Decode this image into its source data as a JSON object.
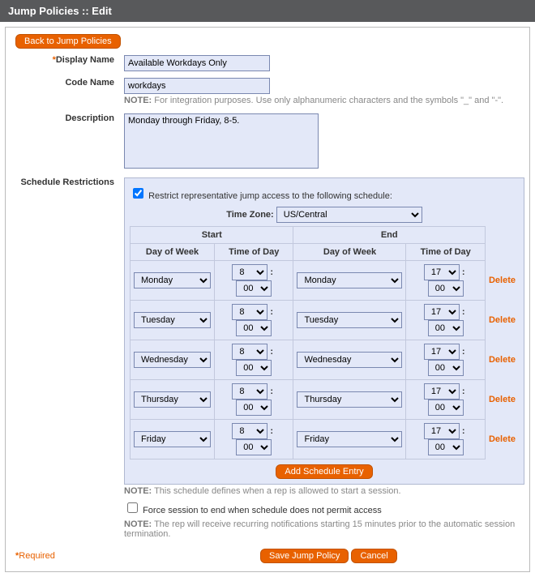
{
  "header_title": "Jump Policies :: Edit",
  "back_button": "Back to Jump Policies",
  "labels": {
    "display_name": "Display Name",
    "code_name": "Code Name",
    "description": "Description",
    "schedule_restrictions": "Schedule Restrictions"
  },
  "fields": {
    "display_name": "Available Workdays Only",
    "code_name": "workdays",
    "description": "Monday through Friday, 8-5."
  },
  "code_name_note_strong": "NOTE:",
  "code_name_note": " For integration purposes. Use only alphanumeric characters and the symbols \"_\" and \"-\".",
  "restrict_checked": true,
  "restrict_label": " Restrict representative jump access to the following schedule:",
  "timezone_label": "Time Zone: ",
  "timezone_value": "US/Central",
  "sched_headers": {
    "start": "Start",
    "end": "End",
    "day_of_week": "Day of Week",
    "time_of_day": "Time of Day"
  },
  "rows": [
    {
      "start_day": "Monday",
      "start_hr": "8",
      "start_min": "00",
      "end_day": "Monday",
      "end_hr": "17",
      "end_min": "00"
    },
    {
      "start_day": "Tuesday",
      "start_hr": "8",
      "start_min": "00",
      "end_day": "Tuesday",
      "end_hr": "17",
      "end_min": "00"
    },
    {
      "start_day": "Wednesday",
      "start_hr": "8",
      "start_min": "00",
      "end_day": "Wednesday",
      "end_hr": "17",
      "end_min": "00"
    },
    {
      "start_day": "Thursday",
      "start_hr": "8",
      "start_min": "00",
      "end_day": "Thursday",
      "end_hr": "17",
      "end_min": "00"
    },
    {
      "start_day": "Friday",
      "start_hr": "8",
      "start_min": "00",
      "end_day": "Friday",
      "end_hr": "17",
      "end_min": "00"
    }
  ],
  "delete_label": "Delete",
  "add_entry": "Add Schedule Entry",
  "schedule_note_strong": "NOTE:",
  "schedule_note": " This schedule defines when a rep is allowed to start a session.",
  "force_checked": false,
  "force_label": " Force session to end when schedule does not permit access",
  "force_note_strong": "NOTE:",
  "force_note": " The rep will receive recurring notifications starting 15 minutes prior to the automatic session termination.",
  "required_label": "Required",
  "save_label": "Save Jump Policy",
  "cancel_label": "Cancel",
  "required_marker": "*"
}
